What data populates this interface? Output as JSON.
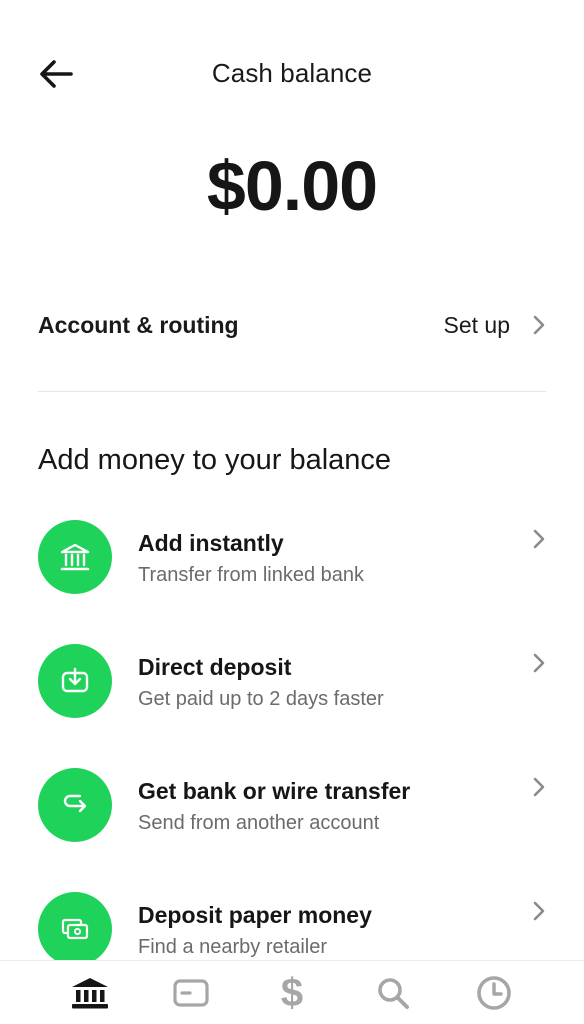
{
  "header": {
    "title": "Cash balance",
    "back_icon": "arrow-left-icon"
  },
  "balance": {
    "amount": "$0.00"
  },
  "account": {
    "label": "Account & routing",
    "action": "Set up",
    "chevron_icon": "chevron-right-icon"
  },
  "section": {
    "title": "Add money to your balance"
  },
  "items": [
    {
      "title": "Add instantly",
      "subtitle": "Transfer from linked bank",
      "icon": "bank-icon"
    },
    {
      "title": "Direct deposit",
      "subtitle": "Get paid up to 2 days faster",
      "icon": "deposit-icon"
    },
    {
      "title": "Get bank or wire transfer",
      "subtitle": "Send from another account",
      "icon": "transfer-icon"
    },
    {
      "title": "Deposit paper money",
      "subtitle": "Find a nearby retailer",
      "icon": "cash-icon"
    }
  ],
  "tabbar": {
    "tabs": [
      {
        "name": "home",
        "icon": "bank-icon",
        "active": true
      },
      {
        "name": "card",
        "icon": "card-icon",
        "active": false
      },
      {
        "name": "pay",
        "icon": "dollar-icon",
        "glyph": "$",
        "active": false
      },
      {
        "name": "search",
        "icon": "search-icon",
        "active": false
      },
      {
        "name": "activity",
        "icon": "clock-icon",
        "active": false
      }
    ]
  },
  "colors": {
    "accent": "#1fd35a",
    "text": "#161616",
    "muted": "#6b6b6b",
    "tab_inactive": "#a6a6a6"
  }
}
